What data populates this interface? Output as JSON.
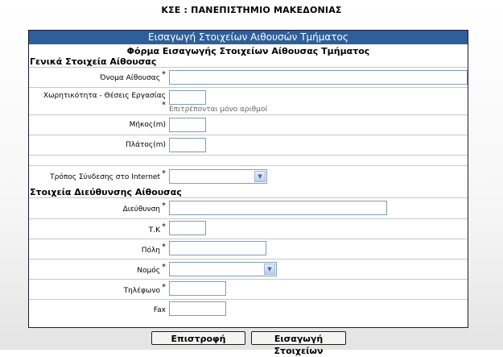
{
  "top_title": "ΚΣΕ : ΠΑΝΕΠΙΣΤΗΜΙΟ ΜΑΚΕΔΟΝΙΑΣ",
  "panel_header": "Εισαγωγή Στοιχείων Αιθουσών Τμήματος",
  "form_title": "Φόρμα Εισαγωγής Στοιχείων Αίθουσας Τμήματος",
  "sections": {
    "general": "Γενικά Στοιχεία Αίθουσας",
    "address": "Στοιχεία Διεύθυνσης Αίθουσας"
  },
  "fields": {
    "room_name": {
      "label": "Όνομα Αίθουσας",
      "required": "*",
      "value": ""
    },
    "capacity": {
      "label": "Χωρητικότητα - Θέσεις Εργασίας",
      "required": "*",
      "value": "",
      "hint": "Επιτρέπονται μόνο αριθμοί"
    },
    "length": {
      "label": "Μήκος(m)",
      "value": ""
    },
    "width": {
      "label": "Πλάτος(m)",
      "value": ""
    },
    "internet": {
      "label": "Τρόπος Σύνδεσης στο Internet",
      "required": "*",
      "selected": ""
    },
    "street": {
      "label": "Διεύθυνση",
      "required": "*",
      "value": ""
    },
    "postal_code": {
      "label": "Τ.Κ",
      "required": "*",
      "value": ""
    },
    "city": {
      "label": "Πόλη",
      "required": "*",
      "value": ""
    },
    "prefecture": {
      "label": "Νομός",
      "required": "*",
      "selected": ""
    },
    "phone": {
      "label": "Τηλέφωνο",
      "required": "*",
      "value": ""
    },
    "fax": {
      "label": "Fax",
      "value": ""
    }
  },
  "buttons": {
    "back": "Επιστροφή",
    "submit": "Εισαγωγή Στοιχείων"
  }
}
